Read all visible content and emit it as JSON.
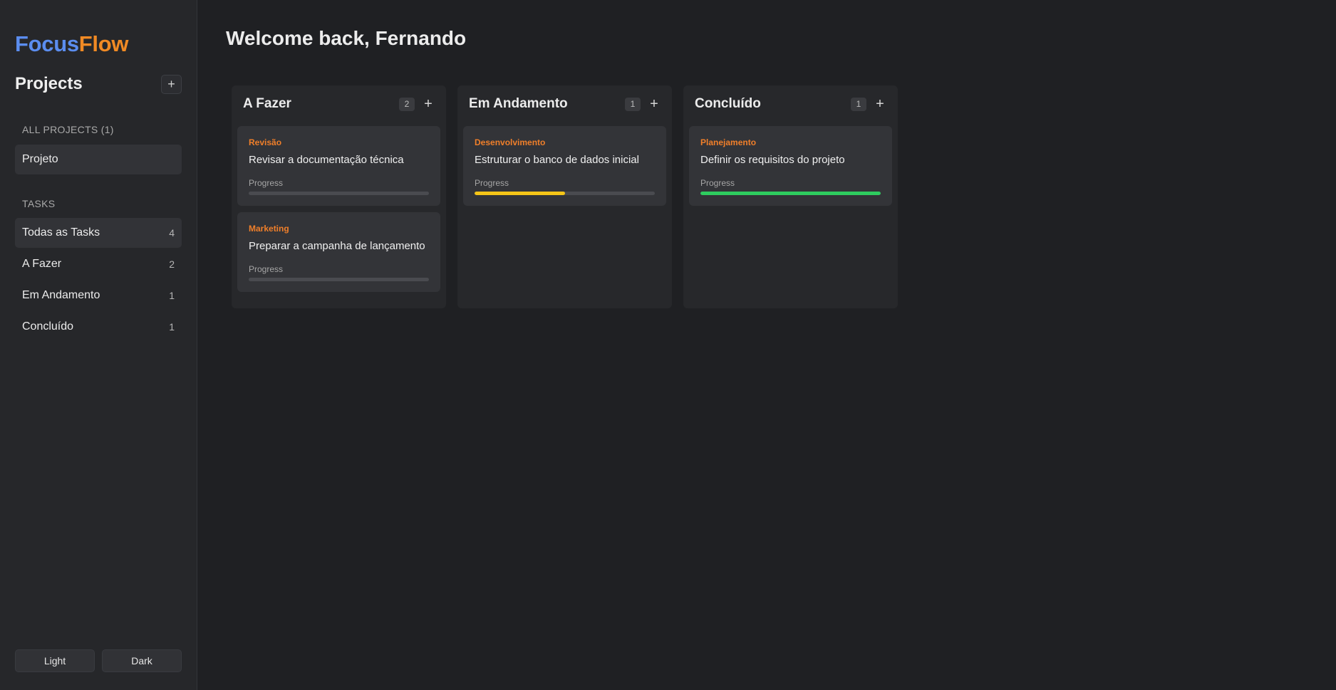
{
  "app": {
    "logo_part1": "Focus",
    "logo_part2": "Flow"
  },
  "sidebar": {
    "projects_title": "Projects",
    "add_project_icon": "plus-icon",
    "all_projects_label": "ALL PROJECTS (1)",
    "projects": [
      {
        "label": "Projeto"
      }
    ],
    "tasks_label": "TASKS",
    "task_filters": [
      {
        "label": "Todas as Tasks",
        "count": "4"
      },
      {
        "label": "A Fazer",
        "count": "2"
      },
      {
        "label": "Em Andamento",
        "count": "1"
      },
      {
        "label": "Concluído",
        "count": "1"
      }
    ],
    "theme_light": "Light",
    "theme_dark": "Dark"
  },
  "main": {
    "welcome": "Welcome back, Fernando",
    "columns": [
      {
        "title": "A Fazer",
        "count": "2",
        "cards": [
          {
            "category": "Revisão",
            "title": "Revisar a documentação técnica",
            "progress_label": "Progress",
            "progress": 0,
            "color": "#4a4b50"
          },
          {
            "category": "Marketing",
            "title": "Preparar a campanha de lançamento",
            "progress_label": "Progress",
            "progress": 0,
            "color": "#4a4b50"
          }
        ]
      },
      {
        "title": "Em Andamento",
        "count": "1",
        "cards": [
          {
            "category": "Desenvolvimento",
            "title": "Estruturar o banco de dados inicial",
            "progress_label": "Progress",
            "progress": 50,
            "color": "#f5c518"
          }
        ]
      },
      {
        "title": "Concluído",
        "count": "1",
        "cards": [
          {
            "category": "Planejamento",
            "title": "Definir os requisitos do projeto",
            "progress_label": "Progress",
            "progress": 100,
            "color": "#2ecc5f"
          }
        ]
      }
    ]
  },
  "colors": {
    "accent_blue": "#5b8def",
    "accent_orange": "#f08a24"
  }
}
